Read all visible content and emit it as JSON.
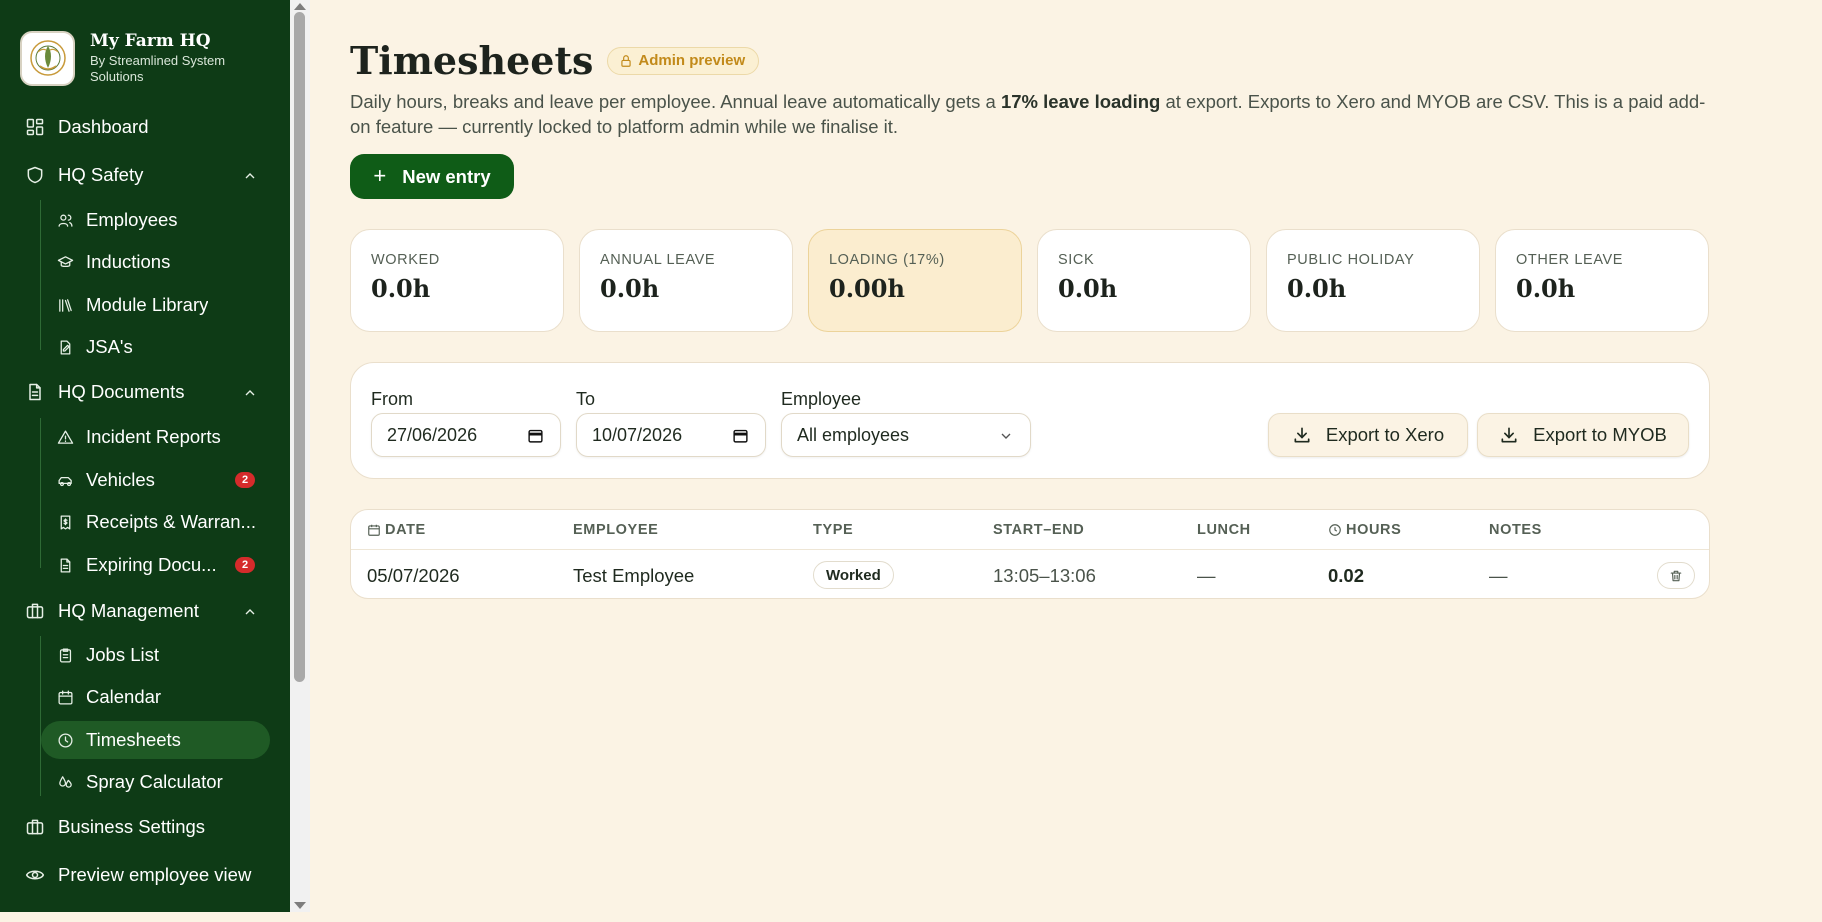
{
  "brand": {
    "title": "My Farm HQ",
    "subtitle": "By Streamlined System Solutions"
  },
  "sidebar": {
    "dashboard": "Dashboard",
    "hq_safety": {
      "label": "HQ Safety",
      "items": [
        "Employees",
        "Inductions",
        "Module Library",
        "JSA's"
      ]
    },
    "hq_documents": {
      "label": "HQ Documents",
      "items": [
        {
          "label": "Incident Reports",
          "badge": ""
        },
        {
          "label": "Vehicles",
          "badge": "2"
        },
        {
          "label": "Receipts & Warran...",
          "badge": ""
        },
        {
          "label": "Expiring Docu...",
          "badge": "2"
        }
      ]
    },
    "hq_management": {
      "label": "HQ Management",
      "items": [
        "Jobs List",
        "Calendar",
        "Timesheets",
        "Spray Calculator"
      ],
      "active": "Timesheets"
    },
    "business_settings": "Business Settings",
    "preview_employee": "Preview employee view"
  },
  "header": {
    "title": "Timesheets",
    "admin_pill": "Admin preview",
    "description_pre": "Daily hours, breaks and leave per employee. Annual leave automatically gets a ",
    "description_bold": "17% leave loading",
    "description_post": " at export. Exports to Xero and MYOB are CSV. This is a paid add-on feature — currently locked to platform admin while we finalise it."
  },
  "actions": {
    "new_entry": "New entry"
  },
  "stats": [
    {
      "label": "WORKED",
      "value": "0.0h"
    },
    {
      "label": "ANNUAL LEAVE",
      "value": "0.0h"
    },
    {
      "label": "LOADING (17%)",
      "value": "0.00h"
    },
    {
      "label": "SICK",
      "value": "0.0h"
    },
    {
      "label": "PUBLIC HOLIDAY",
      "value": "0.0h"
    },
    {
      "label": "OTHER LEAVE",
      "value": "0.0h"
    }
  ],
  "filters": {
    "from_label": "From",
    "from_value": "27/06/2026",
    "to_label": "To",
    "to_value": "10/07/2026",
    "employee_label": "Employee",
    "employee_value": "All employees",
    "export_xero": "Export to Xero",
    "export_myob": "Export to MYOB"
  },
  "table": {
    "headers": [
      "DATE",
      "EMPLOYEE",
      "TYPE",
      "START–END",
      "LUNCH",
      "HOURS",
      "NOTES"
    ],
    "rows": [
      {
        "date": "05/07/2026",
        "employee": "Test Employee",
        "type": "Worked",
        "start_end": "13:05–13:06",
        "lunch": "—",
        "hours": "0.02",
        "notes": "—"
      }
    ]
  },
  "colors": {
    "sidebar_bg": "#0e3b16",
    "page_bg": "#fbf3e4",
    "primary": "#0f5c17",
    "accent_badge": "#d52b2b",
    "pill_text": "#c28a1a"
  }
}
